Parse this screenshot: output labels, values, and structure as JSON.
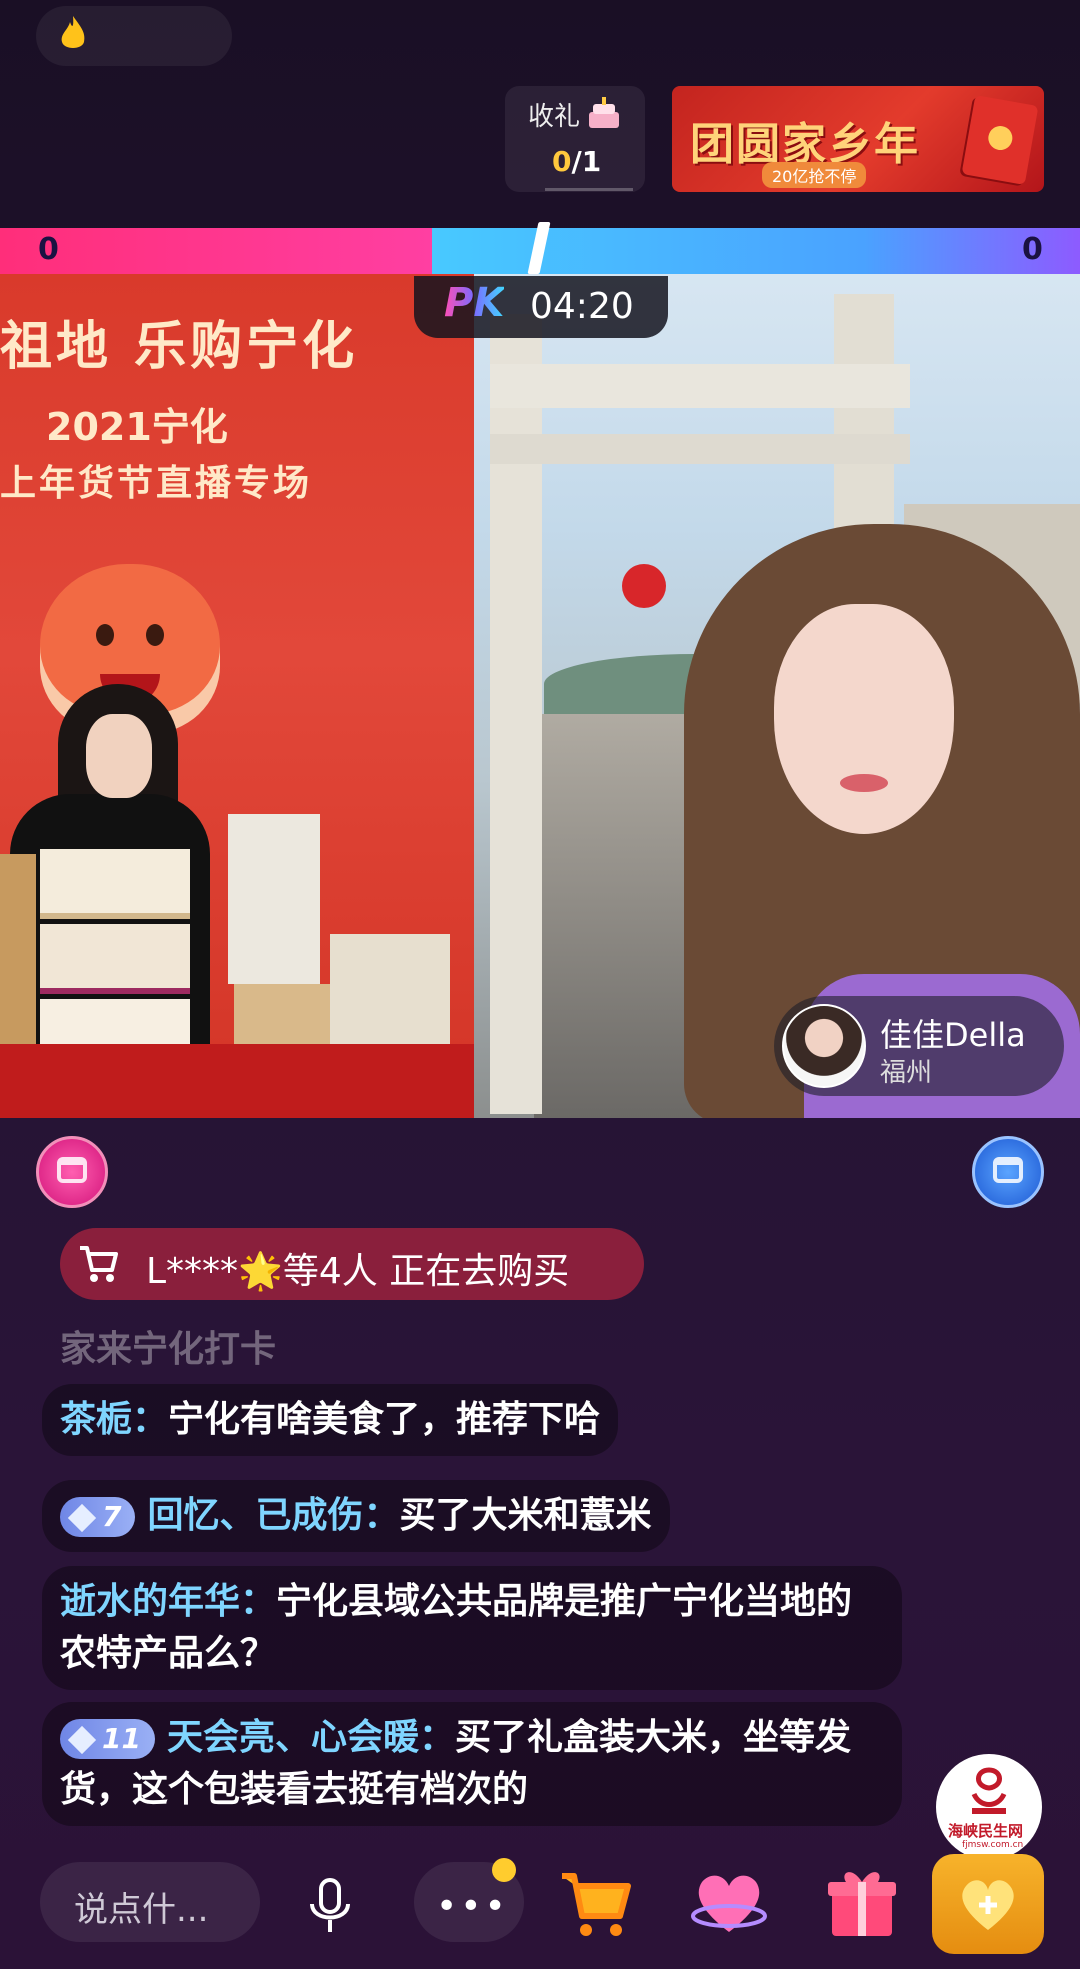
{
  "top": {
    "gift_label": "收礼",
    "gift_current": "0",
    "gift_total": "/1",
    "banner_title": "团圆家乡年",
    "banner_sub": "20亿抢不停"
  },
  "pk": {
    "score_left": "0",
    "score_right": "0",
    "logo": "PK",
    "timer": "04:20"
  },
  "left_stream": {
    "headline": "祖地 乐购宁化",
    "year": "2021宁化",
    "fest": "上年货节直播专场"
  },
  "opponent": {
    "name": "佳佳Della",
    "city": "福州"
  },
  "chat": {
    "buy_notice": "L****🌟等4人 正在去购买",
    "faded": "家来宁化打卡",
    "messages": [
      {
        "name": "茶栀：",
        "text": "宁化有啥美食了，推荐下哈"
      },
      {
        "level": "7",
        "name": "回忆、已成伤：",
        "text": "买了大米和薏米"
      },
      {
        "name": "逝水的年华：",
        "text": "宁化县域公共品牌是推广宁化当地的农特产品么？"
      },
      {
        "level": "11",
        "name": "天会亮、心会暖：",
        "text": "买了礼盒装大米，坐等发货，这个包装看去挺有档次的"
      }
    ]
  },
  "toolbar": {
    "say_placeholder": "说点什...",
    "more": "•••"
  },
  "watermark": {
    "text": "海峡民生网",
    "sub": "fjmsw.com.cn"
  },
  "colors": {
    "pk_left": "#ff2e7a",
    "pk_right": "#4aa2ff",
    "chat_name": "#7fd5ff",
    "buy_pill": "#8a1f3c"
  }
}
